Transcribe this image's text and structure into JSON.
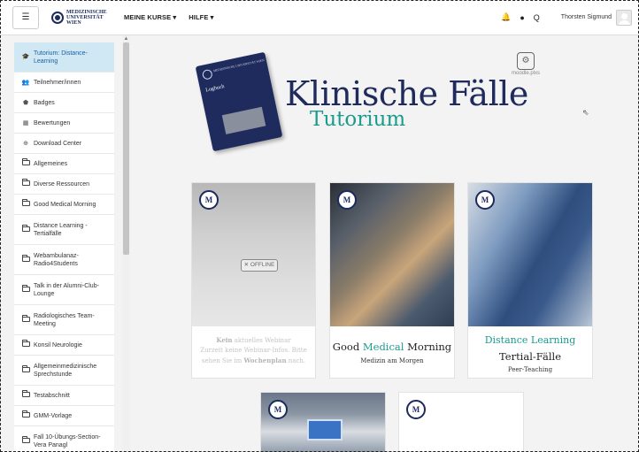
{
  "navbar": {
    "menu_icon": "☰",
    "logo_line1": "MEDIZINISCHE",
    "logo_line2": "UNIVERSITÄT WIEN",
    "menu_courses": "MEINE KURSE ▾",
    "menu_help": "HILFE ▾",
    "bell_icon": "🔔",
    "chat_icon": "●",
    "search_icon": "Q",
    "user_name": "Thorsten Sigmund"
  },
  "sidebar": {
    "items": [
      {
        "label": "Tutorium: Distance-Learning",
        "icon": "🎓"
      },
      {
        "label": "Teilnehmer/innen",
        "icon": "👥"
      },
      {
        "label": "Badges",
        "icon": "⬟"
      },
      {
        "label": "Bewertungen",
        "icon": "▦"
      },
      {
        "label": "Download Center",
        "icon": "⊕"
      },
      {
        "label": "Allgemeines"
      },
      {
        "label": "Diverse Ressourcen"
      },
      {
        "label": "Good Medical Morning"
      },
      {
        "label": "Distance Learning - Tertialfälle"
      },
      {
        "label": "Webambulanaz-Radio4Students"
      },
      {
        "label": "Talk in der Alumni-Club-Lounge"
      },
      {
        "label": "Radiologisches Team-Meeting"
      },
      {
        "label": "Konsil Neurologie"
      },
      {
        "label": "Allgemeinmedizinische Sprechstunde"
      },
      {
        "label": "Testabschnitt"
      },
      {
        "label": "GMM-Vorlage"
      },
      {
        "label": "Fall 10-Übungs-Section-Vera Panagl"
      }
    ]
  },
  "banner": {
    "logbook_line1": "MEDIZINISCHE UNIVERSITÄT WIEN",
    "logbook_title": "Logbuch",
    "title": "Klinische Fälle",
    "subtitle": "Tutorium",
    "plexi_label": "moodle.plxs"
  },
  "cards": {
    "card1": {
      "offline_label": "✕ OFFLINE",
      "text_bold1": "Kein",
      "text1": " aktuelles Webinar",
      "text2": "Zurzeit keine Webinar-Infos. Bitte sehen Sie im ",
      "text_bold2": "Wochenplan",
      "text3": " nach."
    },
    "card2": {
      "title_a": "Good ",
      "title_hl": "Medical",
      "title_b": " Morning",
      "subtitle": "Medizin am Morgen"
    },
    "card3": {
      "title1": "Distance Learning",
      "title2": "Tertial-Fälle",
      "subtitle": "Peer-Teaching"
    },
    "badge_letter": "M"
  }
}
